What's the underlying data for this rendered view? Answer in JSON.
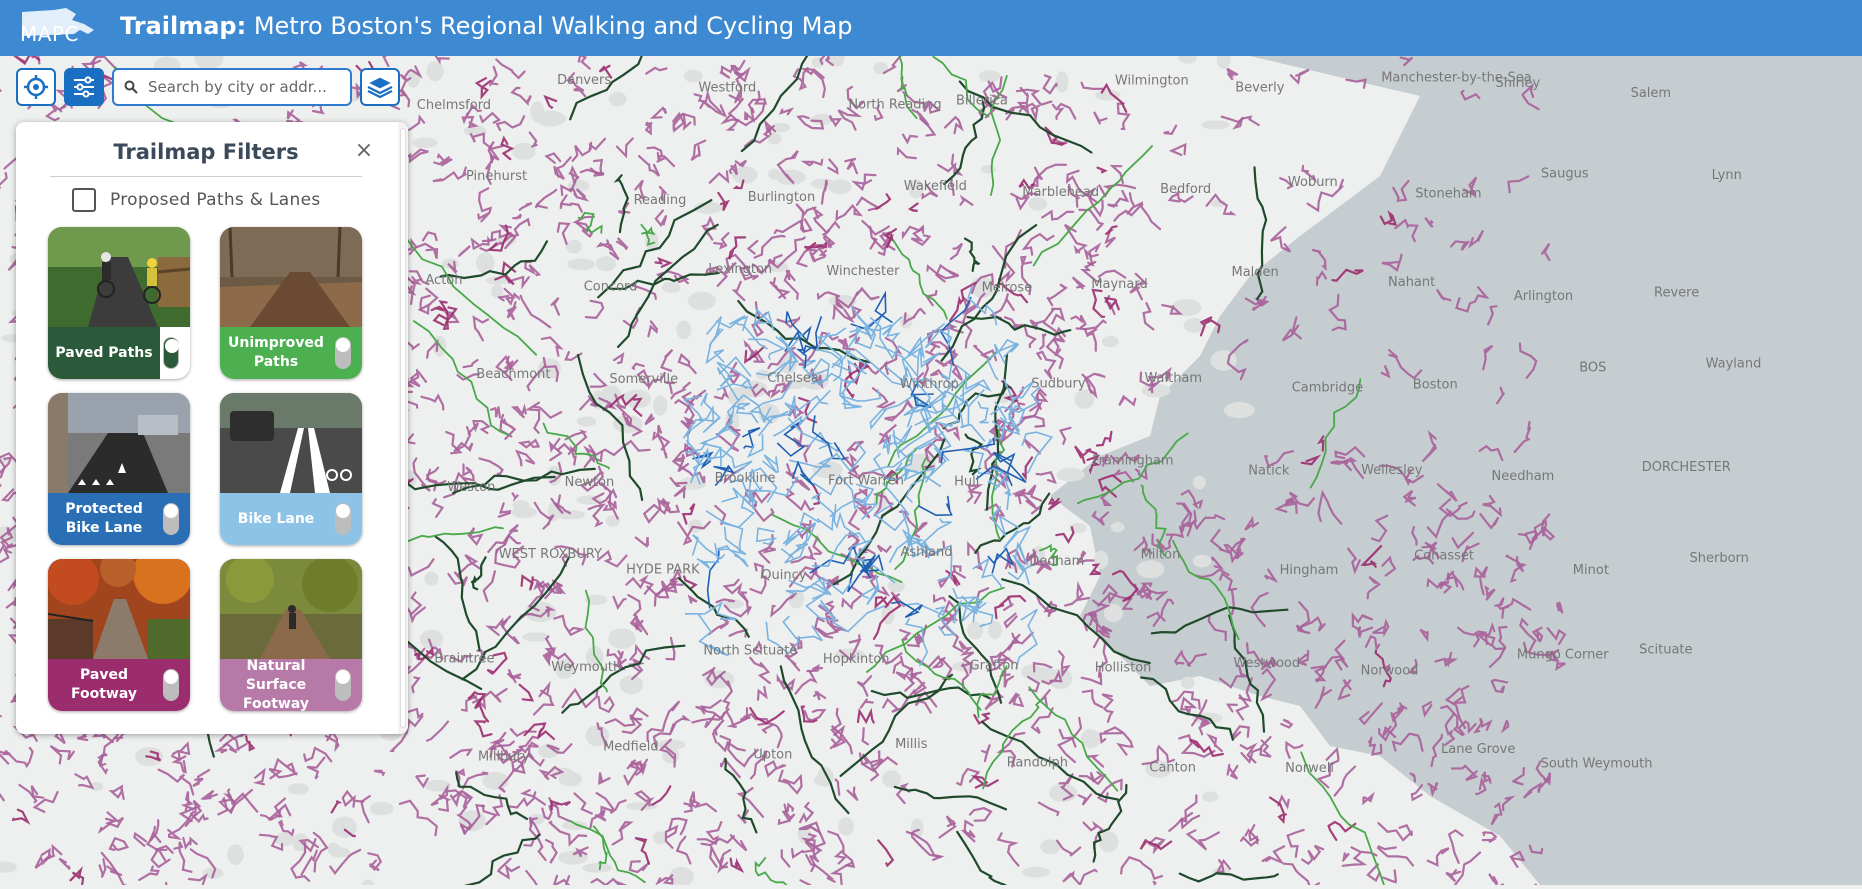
{
  "header": {
    "logo_text": "MAPC",
    "title_bold": "Trailmap:",
    "title_rest": " Metro Boston's Regional Walking and Cycling Map"
  },
  "toolbar": {
    "search_placeholder": "Search by city or addr..."
  },
  "filters": {
    "title": "Trailmap Filters",
    "close_symbol": "×",
    "proposed_label": "Proposed Paths & Lanes",
    "proposed_checked": false,
    "cards": [
      {
        "label": "Paved Paths",
        "color": "#2b5a3a",
        "enabled": false
      },
      {
        "label": "Unimproved Paths",
        "color": "#4caf50",
        "enabled": false
      },
      {
        "label": "Protected Bike Lane",
        "color": "#2a6fb5",
        "enabled": false
      },
      {
        "label": "Bike Lane",
        "color": "#8cc3e6",
        "enabled": false
      },
      {
        "label": "Paved Footway",
        "color": "#9b2c6e",
        "enabled": false
      },
      {
        "label": "Natural Surface Footway",
        "color": "#b779a8",
        "enabled": false
      }
    ]
  },
  "map": {
    "colors": {
      "land": "#eef0ef",
      "water": "#c6cdd0",
      "paved_footway": "#9b2c6e",
      "natural_footway": "#a8609a",
      "paved_path": "#1f4a2c",
      "unimproved_path": "#49a84a",
      "bike_lane": "#7ab3e0",
      "protected_lane": "#1f5fb3"
    },
    "places": [
      "Chelmsford",
      "Danvers",
      "Westford",
      "North Reading",
      "Billerica",
      "Wilmington",
      "Beverly",
      "Manchester-by-the-Sea",
      "Shirley",
      "Salem",
      "Pinehurst",
      "Reading",
      "Burlington",
      "Wakefield",
      "Marblehead",
      "Bedford",
      "Woburn",
      "Stoneham",
      "Saugus",
      "Lynn",
      "Acton",
      "Concord",
      "Lexington",
      "Winchester",
      "Melrose",
      "Maynard",
      "Malden",
      "Nahant",
      "Arlington",
      "Revere",
      "Beachmont",
      "Somerville",
      "Chelsea",
      "Winthrop",
      "Sudbury",
      "Waltham",
      "Cambridge",
      "Boston",
      "BOS",
      "Wayland",
      "Weston",
      "Newton",
      "Brookline",
      "Fort Warren",
      "Hull",
      "Framingham",
      "Natick",
      "Wellesley",
      "Needham",
      "DORCHESTER",
      "WEST ROXBURY",
      "HYDE PARK",
      "Quincy",
      "Ashland",
      "Dedham",
      "Milton",
      "Hingham",
      "Cohasset",
      "Minot",
      "Sherborn",
      "Braintree",
      "Weymouth",
      "North Scituate",
      "Hopkinton",
      "Grafton",
      "Holliston",
      "Westwood",
      "Norwood",
      "Mungo Corner",
      "Scituate",
      "Millbury",
      "Medfield",
      "Upton",
      "Millis",
      "Randolph",
      "Canton",
      "Norwell",
      "Lane Grove",
      "South Weymouth"
    ]
  }
}
